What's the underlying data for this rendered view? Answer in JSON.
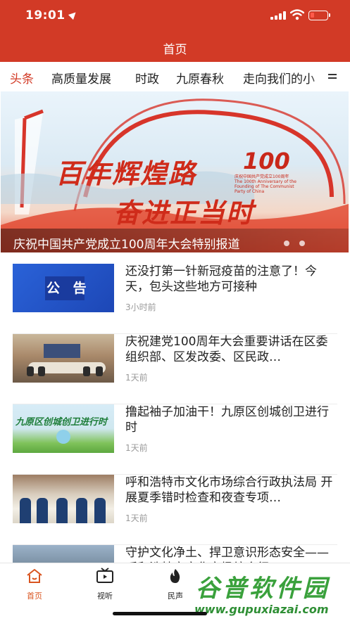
{
  "status_bar": {
    "time": "19:01"
  },
  "header": {
    "title": "首页"
  },
  "tabs": [
    {
      "label": "头条",
      "active": true
    },
    {
      "label": "高质量发展",
      "active": false
    },
    {
      "label": "时政",
      "active": false
    },
    {
      "label": "九原春秋",
      "active": false
    },
    {
      "label": "走向我们的小",
      "active": false
    }
  ],
  "banner": {
    "headline_1": "百年辉煌路",
    "headline_2": "奋进正当时",
    "logo_number": "100",
    "logo_text": "庆祝中国共产党成立100周年 The 100th Anniversary of the Founding of The Communist Party of China",
    "caption": "庆祝中国共产党成立100周年大会特别报道"
  },
  "news": [
    {
      "thumb_text": "公 告",
      "title": "还没打第一针新冠疫苗的注意了！今天，包头这些地方可接种",
      "time": "3小时前"
    },
    {
      "title": "庆祝建党100周年大会重要讲话在区委组织部、区发改委、区民政…",
      "time": "1天前"
    },
    {
      "thumb_text": "九原区创城创卫进行时",
      "title": "撸起袖子加油干！九原区创城创卫进行时",
      "time": "1天前"
    },
    {
      "title": "呼和浩特市文化市场综合行政执法局 开展夏季错时检查和夜查专项…",
      "time": "1天前"
    },
    {
      "title": "守护文化净土、捍卫意识形态安全——呼和浩特市文化市场综合行…",
      "time": ""
    }
  ],
  "bottom_nav": [
    {
      "label": "首页",
      "icon": "home-icon",
      "active": true
    },
    {
      "label": "视听",
      "icon": "tv-icon",
      "active": false
    },
    {
      "label": "民声",
      "icon": "flame-icon",
      "active": false
    }
  ],
  "watermark": {
    "text": "谷普软件园",
    "url": "www.gupuxiazai.com"
  },
  "colors": {
    "brand_red": "#d23a26",
    "active_tab": "#d23a26",
    "nav_active": "#d9541f"
  }
}
